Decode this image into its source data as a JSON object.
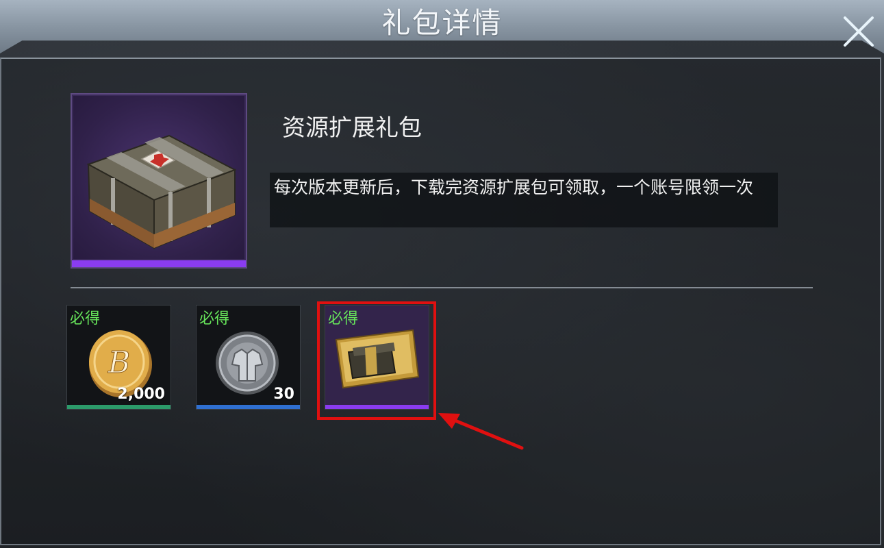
{
  "dialog": {
    "title": "礼包详情"
  },
  "pack": {
    "name": "资源扩展礼包",
    "description": "每次版本更新后，下载完资源扩展包可领取，一个账号限领一次",
    "icon": "supply-crate-icon",
    "rarity_color": "#8a3cf0"
  },
  "rewards": [
    {
      "tag": "必得",
      "quantity": "2,000",
      "icon": "bp-coin-icon",
      "rarity_color": "#2c9a6a"
    },
    {
      "tag": "必得",
      "quantity": "30",
      "icon": "outfit-badge-icon",
      "rarity_color": "#2f6fd0"
    },
    {
      "tag": "必得",
      "quantity": "",
      "icon": "crate-coupon-icon",
      "rarity_color": "#8a3cf0"
    }
  ],
  "colors": {
    "guaranteed_tag": "#66e35a",
    "highlight": "#e01010"
  }
}
